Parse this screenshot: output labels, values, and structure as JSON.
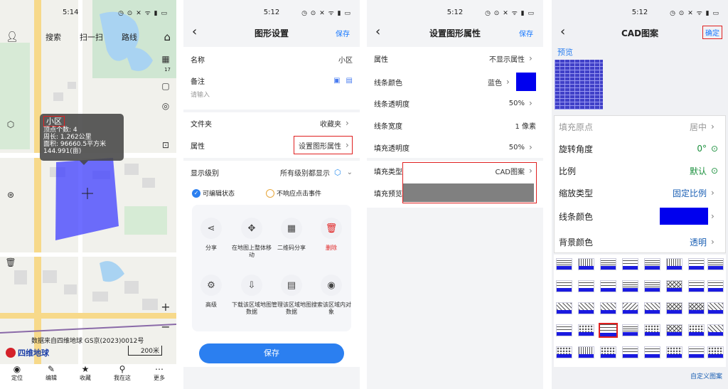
{
  "status": {
    "p1_time": "5:14",
    "p2_time": "5:12",
    "p3_time": "5:12",
    "p4_time": "5:12",
    "icons": "◷ ⊙ ✕ ᯤ ▮ ▭"
  },
  "map": {
    "search": "搜索",
    "scan": "扫一扫",
    "route": "路线",
    "popup_title": "小区",
    "popup_l1": "顶点个数: 4",
    "popup_l2": "周长: 1.262公里",
    "popup_l3": "面积: 96660.5平方米",
    "popup_l4": "144.991(亩)",
    "source": "数据来自四维地球 GS京(2023)0012号",
    "logo": "四维地球",
    "scale": "200米",
    "layers_level": "17",
    "bottom": [
      "定位",
      "编辑",
      "收藏",
      "我在这",
      "更多"
    ],
    "plus": "+",
    "minus": "−"
  },
  "shape": {
    "title": "图形设置",
    "save": "保存",
    "name_label": "名称",
    "name_value": "小区",
    "note_label": "备注",
    "note_placeholder": "请输入",
    "folder_label": "文件夹",
    "folder_value": "收藏夹",
    "attr_label": "属性",
    "attr_value": "设置图形属性",
    "level_label": "显示级别",
    "level_value": "所有级别都显示",
    "edit_check": "可编辑状态",
    "no_click": "不响应点击事件",
    "actions": [
      "分享",
      "在地图上整体移动",
      "二维码分享",
      "删除",
      "高级",
      "下载该区域地图数据",
      "管理该区域地图数据",
      "搜索该区域内对象"
    ],
    "save_btn": "保存"
  },
  "attr": {
    "title": "设置图形属性",
    "save": "保存",
    "rows": [
      {
        "label": "属性",
        "value": "不显示属性"
      },
      {
        "label": "线条颜色",
        "value": "蓝色"
      },
      {
        "label": "线条透明度",
        "value": "50%"
      },
      {
        "label": "线条宽度",
        "value": "1 像素"
      },
      {
        "label": "填充透明度",
        "value": "50%"
      },
      {
        "label": "填充类型",
        "value": "CAD图案"
      },
      {
        "label": "填充预览",
        "value": ""
      }
    ],
    "line_color": "#0000ee",
    "preview_color": "#808080"
  },
  "cad": {
    "title": "CAD图案",
    "confirm": "确定",
    "preview_label": "预览",
    "rows": [
      {
        "label": "填充原点",
        "value": "居中"
      },
      {
        "label": "旋转角度",
        "value": "0°"
      },
      {
        "label": "比例",
        "value": "默认"
      },
      {
        "label": "缩放类型",
        "value": "固定比例"
      },
      {
        "label": "线条颜色",
        "value": ""
      },
      {
        "label": "背景颜色",
        "value": "透明"
      }
    ],
    "custom": "自定义图案",
    "line_color": "#0000ee"
  }
}
